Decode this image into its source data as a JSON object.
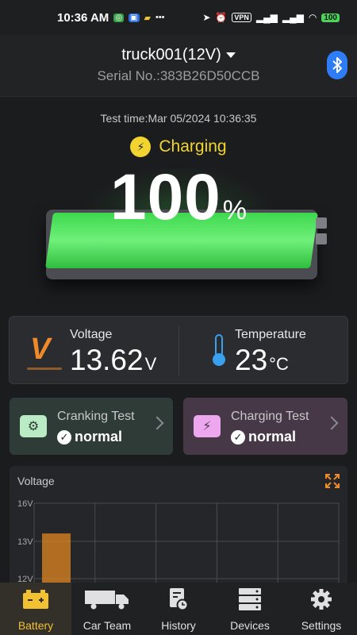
{
  "status_bar": {
    "time": "10:36 AM",
    "vpn": "VPN",
    "battery": "100"
  },
  "header": {
    "device_name": "truck001(12V)",
    "serial": "Serial No.:383B26D50CCB"
  },
  "test": {
    "time": "Test time:Mar 05/2024 10:36:35",
    "state": "Charging",
    "percent": "100",
    "percent_sign": "%",
    "charge_level": 1.0
  },
  "measurements": {
    "voltage_label": "Voltage",
    "voltage_value": "13.62",
    "voltage_unit": "V",
    "temperature_label": "Temperature",
    "temperature_value": "23",
    "temperature_unit": "°C"
  },
  "tests": {
    "cranking": {
      "title": "Cranking Test",
      "status": "normal"
    },
    "charging": {
      "title": "Charging Test",
      "status": "normal"
    }
  },
  "chart": {
    "title": "Voltage"
  },
  "chart_data": {
    "type": "bar",
    "title": "Voltage",
    "y_ticks": [
      "16V",
      "13V",
      "12V"
    ],
    "y_tick_values": [
      16,
      13,
      12
    ],
    "values": [
      13.62
    ],
    "ylim": [
      12,
      16
    ],
    "grid": true,
    "color": "#e0851f"
  },
  "nav": {
    "items": [
      {
        "label": "Battery",
        "icon": "battery-icon",
        "active": true
      },
      {
        "label": "Car Team",
        "icon": "truck-icon",
        "active": false
      },
      {
        "label": "History",
        "icon": "history-icon",
        "active": false
      },
      {
        "label": "Devices",
        "icon": "devices-icon",
        "active": false
      },
      {
        "label": "Settings",
        "icon": "gear-icon",
        "active": false
      }
    ]
  },
  "colors": {
    "accent": "#f2c132",
    "charging": "#f2d431",
    "battery_fill": "#3ed84e",
    "voltage_icon": "#ef8a2a",
    "temperature_icon": "#3aa0f0",
    "bluetooth": "#2e7cf6"
  }
}
